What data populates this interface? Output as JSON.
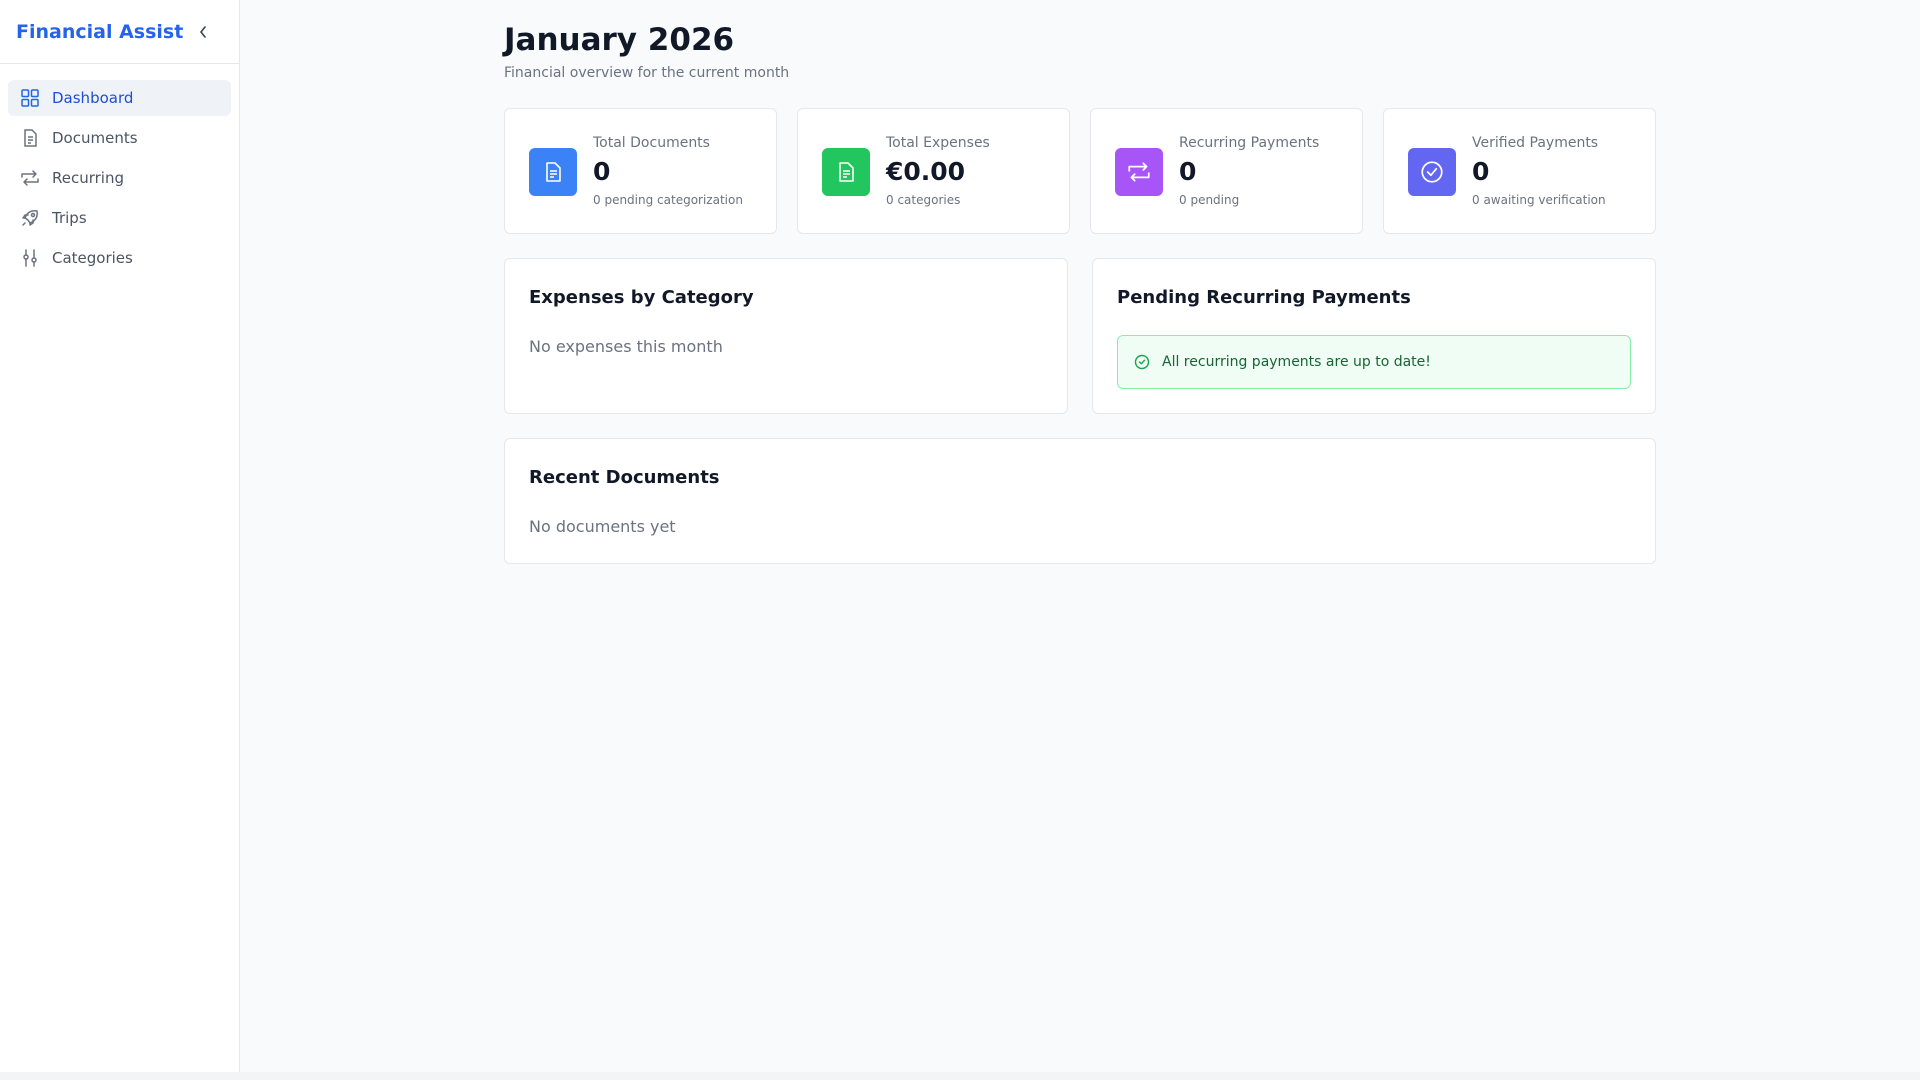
{
  "app": {
    "title": "Financial Assistant"
  },
  "sidebar": {
    "items": [
      {
        "label": "Dashboard",
        "icon": "dashboard-grid-icon",
        "active": true
      },
      {
        "label": "Documents",
        "icon": "document-icon",
        "active": false
      },
      {
        "label": "Recurring",
        "icon": "repeat-icon",
        "active": false
      },
      {
        "label": "Trips",
        "icon": "rocket-icon",
        "active": false
      },
      {
        "label": "Categories",
        "icon": "sliders-icon",
        "active": false
      }
    ]
  },
  "header": {
    "title": "January 2026",
    "subtitle": "Financial overview for the current month"
  },
  "stats": [
    {
      "label": "Total Documents",
      "value": "0",
      "sub": "0 pending categorization",
      "icon": "document-icon",
      "color": "#3b82f6"
    },
    {
      "label": "Total Expenses",
      "value": "€0.00",
      "sub": "0 categories",
      "icon": "document-icon",
      "color": "#22c55e"
    },
    {
      "label": "Recurring Payments",
      "value": "0",
      "sub": "0 pending",
      "icon": "repeat-icon",
      "color": "#a855f7"
    },
    {
      "label": "Verified Payments",
      "value": "0",
      "sub": "0 awaiting verification",
      "icon": "check-circle-icon",
      "color": "#6366f1"
    }
  ],
  "expenses_panel": {
    "title": "Expenses by Category",
    "empty": "No expenses this month"
  },
  "recurring_panel": {
    "title": "Pending Recurring Payments",
    "success": "All recurring payments are up to date!"
  },
  "documents_panel": {
    "title": "Recent Documents",
    "empty": "No documents yet"
  },
  "colors": {
    "accent": "#2563eb",
    "success_bg": "#f0fdf4",
    "success_border": "#86efac",
    "success_text": "#166534"
  }
}
